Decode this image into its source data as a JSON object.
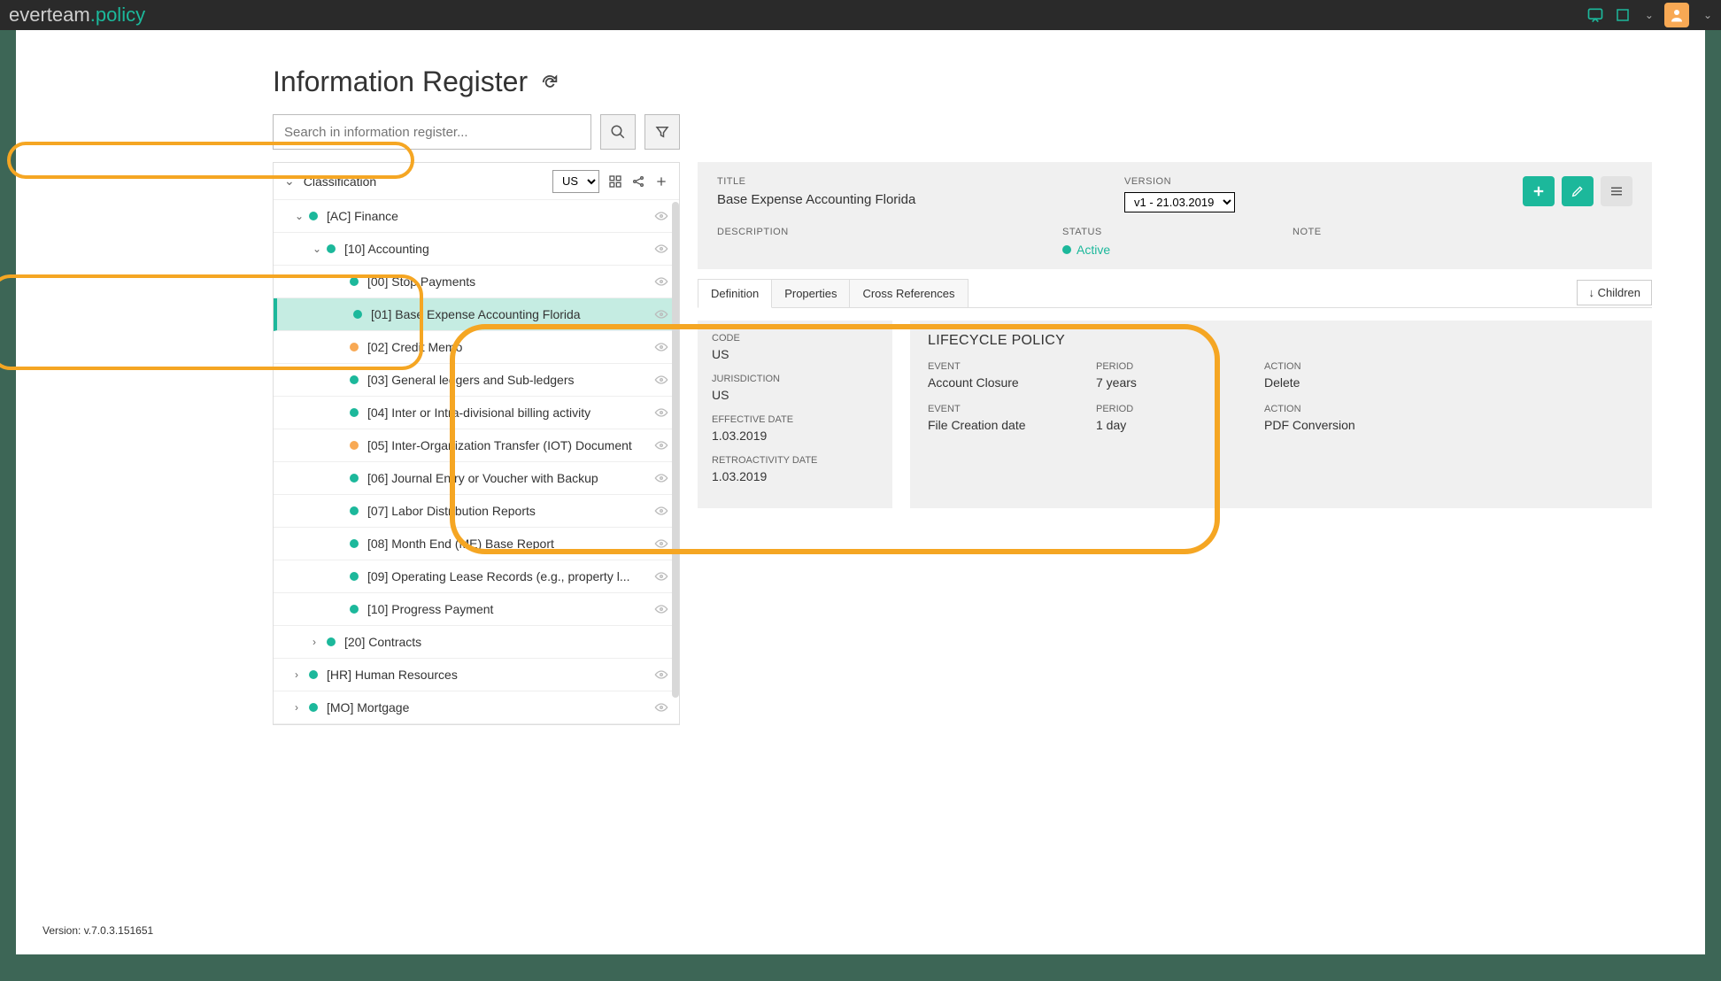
{
  "brand": {
    "part1": "everteam",
    "part2": ".policy"
  },
  "page": {
    "title": "Information Register",
    "search_placeholder": "Search in information register..."
  },
  "tree": {
    "classification_label": "Classification",
    "classification_value": "US",
    "items": [
      {
        "label": "[AC] Finance",
        "level": 1,
        "color": "green",
        "expand": "down",
        "eye": true
      },
      {
        "label": "[10] Accounting",
        "level": 2,
        "color": "green",
        "expand": "down",
        "eye": true
      },
      {
        "label": "[00] Stop Payments",
        "level": 3,
        "color": "green",
        "expand": "",
        "eye": true
      },
      {
        "label": "[01] Base Expense Accounting Florida",
        "level": 3,
        "color": "green",
        "expand": "",
        "eye": true,
        "selected": true
      },
      {
        "label": "[02] Credit Memo",
        "level": 3,
        "color": "orange",
        "expand": "",
        "eye": true
      },
      {
        "label": "[03] General ledgers and Sub-ledgers",
        "level": 3,
        "color": "green",
        "expand": "",
        "eye": true
      },
      {
        "label": "[04] Inter or Intra-divisional billing activity",
        "level": 3,
        "color": "green",
        "expand": "",
        "eye": true
      },
      {
        "label": "[05] Inter-Organization Transfer (IOT) Document",
        "level": 3,
        "color": "orange",
        "expand": "",
        "eye": true
      },
      {
        "label": "[06] Journal Entry or Voucher with Backup",
        "level": 3,
        "color": "green",
        "expand": "",
        "eye": true
      },
      {
        "label": "[07] Labor Distribution Reports",
        "level": 3,
        "color": "green",
        "expand": "",
        "eye": true
      },
      {
        "label": "[08] Month End (ME) Base Report",
        "level": 3,
        "color": "green",
        "expand": "",
        "eye": true
      },
      {
        "label": "[09] Operating Lease Records (e.g., property l...",
        "level": 3,
        "color": "green",
        "expand": "",
        "eye": true
      },
      {
        "label": "[10] Progress Payment",
        "level": 3,
        "color": "green",
        "expand": "",
        "eye": true
      },
      {
        "label": "[20] Contracts",
        "level": 2,
        "color": "green",
        "expand": "right",
        "eye": false
      },
      {
        "label": "[HR] Human Resources",
        "level": 1,
        "color": "green",
        "expand": "right",
        "eye": true
      },
      {
        "label": "[MO] Mortgage",
        "level": 1,
        "color": "green",
        "expand": "right",
        "eye": true
      }
    ]
  },
  "detail": {
    "title_label": "TITLE",
    "title_value": "Base Expense Accounting Florida",
    "version_label": "VERSION",
    "version_value": "v1 - 21.03.2019",
    "desc_label": "DESCRIPTION",
    "status_label": "STATUS",
    "status_value": "Active",
    "note_label": "NOTE",
    "tabs": [
      "Definition",
      "Properties",
      "Cross References"
    ],
    "children_btn": "↓ Children",
    "defn_left": [
      {
        "label": "CODE",
        "value": "US"
      },
      {
        "label": "JURISDICTION",
        "value": "US"
      },
      {
        "label": "EFFECTIVE DATE",
        "value": "1.03.2019"
      },
      {
        "label": "RETROACTIVITY DATE",
        "value": "1.03.2019"
      }
    ],
    "lifecycle_title": "LIFECYCLE POLICY",
    "policies": [
      {
        "event_label": "EVENT",
        "event": "Account Closure",
        "period_label": "PERIOD",
        "period": "7 years",
        "action_label": "ACTION",
        "action": "Delete"
      },
      {
        "event_label": "EVENT",
        "event": "File Creation date",
        "period_label": "PERIOD",
        "period": "1 day",
        "action_label": "ACTION",
        "action": "PDF Conversion"
      }
    ]
  },
  "footer": {
    "version": "Version: v.7.0.3.151651"
  }
}
